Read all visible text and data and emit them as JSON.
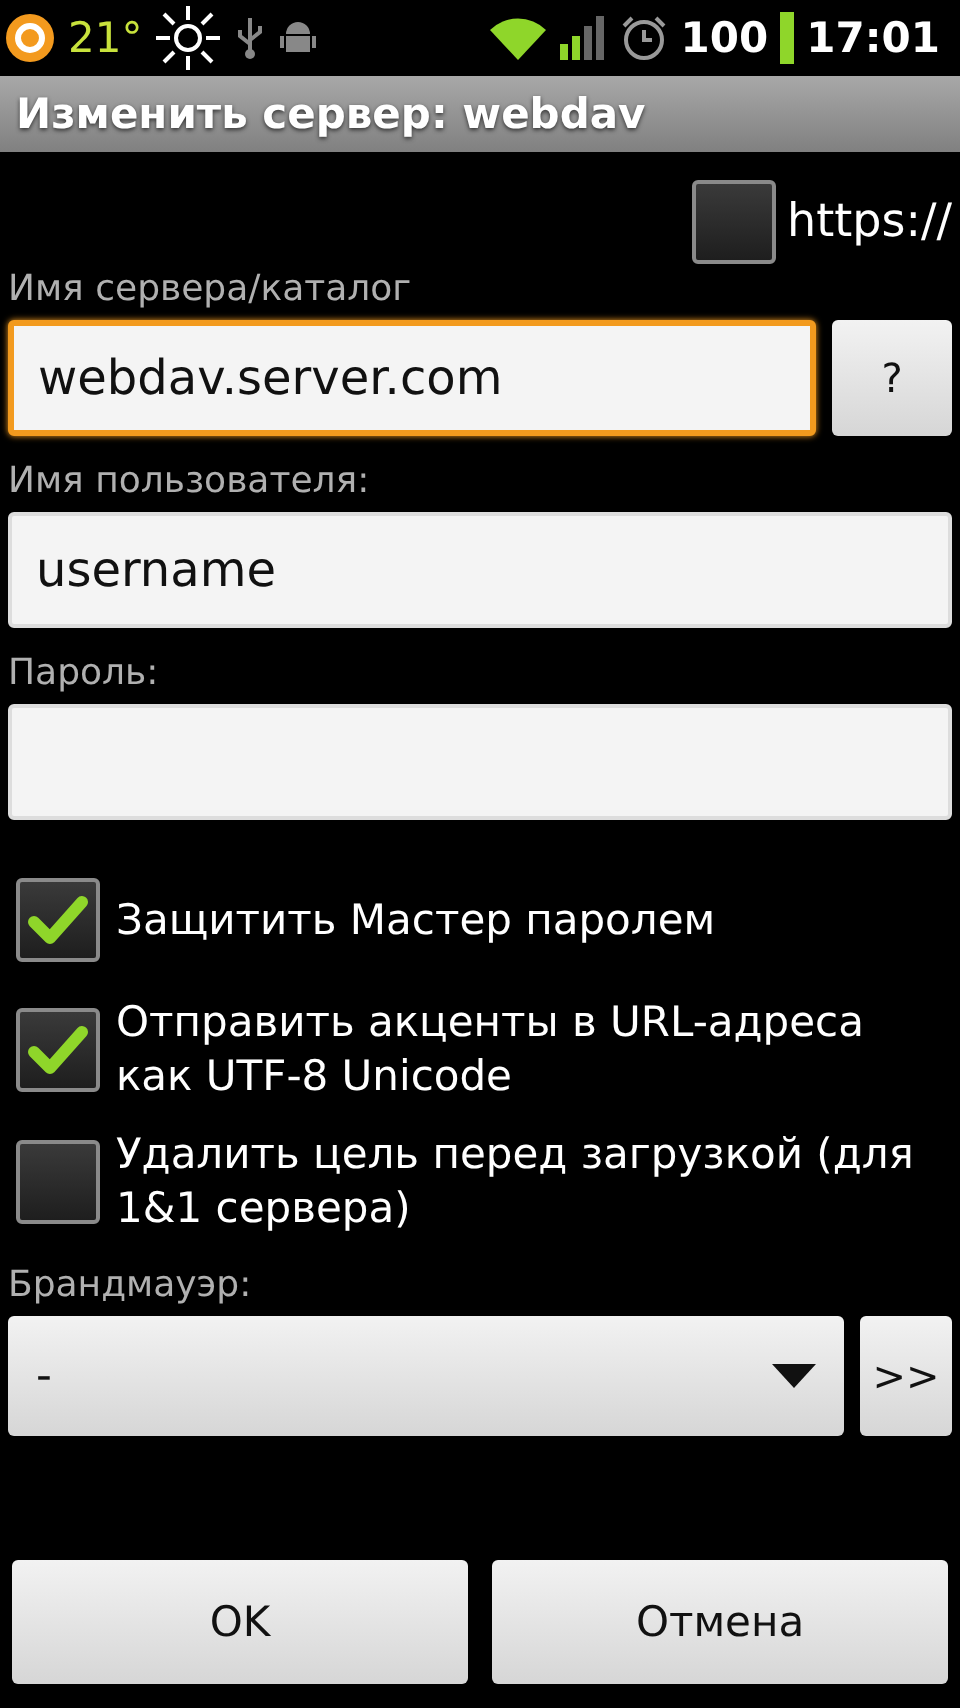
{
  "status_bar": {
    "temperature": "21°",
    "battery": "100",
    "time": "17:01"
  },
  "title": "Изменить сервер: webdav",
  "https": {
    "label": "https://",
    "checked": false
  },
  "fields": [
    {
      "label": "Имя сервера/каталог",
      "value": "webdav.server.com",
      "focused": true,
      "button": "?"
    },
    {
      "label": "Имя пользователя:",
      "value": "username",
      "focused": false
    },
    {
      "label": "Пароль:",
      "focused": false
    }
  ],
  "options": [
    {
      "label": "Защитить Мастер паролем",
      "checked": true
    },
    {
      "label": "Отправить акценты в URL-адреса как UTF-8 Unicode",
      "checked": true
    },
    {
      "label": "Удалить цель перед загрузкой (для 1&1 сервера)",
      "checked": false
    }
  ],
  "firewall": {
    "label": "Брандмауэр:",
    "value": "-",
    "button": ">>"
  },
  "buttons": [
    "OK",
    "Отмена"
  ]
}
